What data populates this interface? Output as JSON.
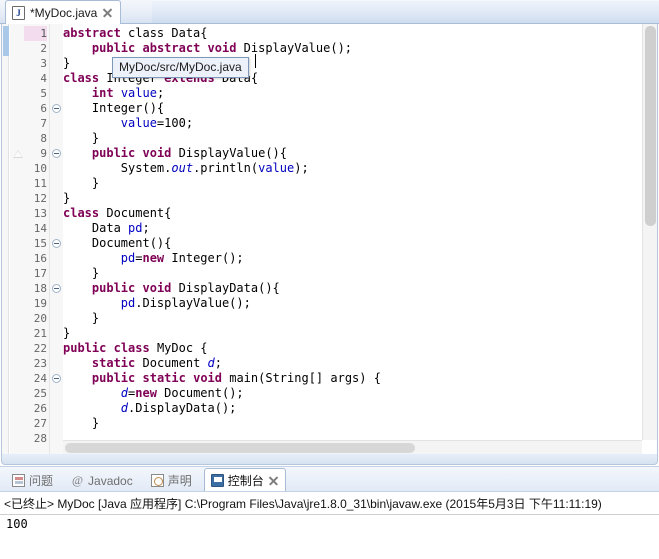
{
  "editor": {
    "tab": {
      "label": "*MyDoc.java",
      "icon": "java-file-icon",
      "close": "close-icon"
    },
    "tooltip": "MyDoc/src/MyDoc.java",
    "lines": [
      {
        "n": "1",
        "current": true,
        "changed": true,
        "fold": false,
        "warn": false,
        "html": "<span class=\"kw\">abstract</span> class Data{"
      },
      {
        "n": "2",
        "current": false,
        "changed": true,
        "fold": false,
        "warn": false,
        "html": "    <span class=\"kw\">public</span> <span class=\"kw\">abstract</span> <span class=\"kw\">void</span> DisplayValue();"
      },
      {
        "n": "3",
        "current": false,
        "changed": false,
        "fold": false,
        "warn": false,
        "html": "}"
      },
      {
        "n": "4",
        "current": false,
        "changed": false,
        "fold": false,
        "warn": false,
        "html": "<span class=\"kw\">class</span> Integer <span class=\"kw\">extends</span> Data{"
      },
      {
        "n": "5",
        "current": false,
        "changed": false,
        "fold": false,
        "warn": false,
        "html": "    <span class=\"kw\">int</span> <span class=\"fld\">value</span>;"
      },
      {
        "n": "6",
        "current": false,
        "changed": false,
        "fold": true,
        "warn": false,
        "html": "    Integer(){"
      },
      {
        "n": "7",
        "current": false,
        "changed": false,
        "fold": false,
        "warn": false,
        "html": "        <span class=\"fld\">value</span>=100;"
      },
      {
        "n": "8",
        "current": false,
        "changed": false,
        "fold": false,
        "warn": false,
        "html": "    }"
      },
      {
        "n": "9",
        "current": false,
        "changed": false,
        "fold": true,
        "warn": true,
        "html": "    <span class=\"kw\">public</span> <span class=\"kw\">void</span> DisplayValue(){"
      },
      {
        "n": "10",
        "current": false,
        "changed": false,
        "fold": false,
        "warn": false,
        "html": "        System.<span class=\"sfld\">out</span>.println(<span class=\"fld\">value</span>);"
      },
      {
        "n": "11",
        "current": false,
        "changed": false,
        "fold": false,
        "warn": false,
        "html": "    }"
      },
      {
        "n": "12",
        "current": false,
        "changed": false,
        "fold": false,
        "warn": false,
        "html": "}"
      },
      {
        "n": "13",
        "current": false,
        "changed": false,
        "fold": false,
        "warn": false,
        "html": "<span class=\"kw\">class</span> Document{"
      },
      {
        "n": "14",
        "current": false,
        "changed": false,
        "fold": false,
        "warn": false,
        "html": "    Data <span class=\"fld\">pd</span>;"
      },
      {
        "n": "15",
        "current": false,
        "changed": false,
        "fold": true,
        "warn": false,
        "html": "    Document(){"
      },
      {
        "n": "16",
        "current": false,
        "changed": false,
        "fold": false,
        "warn": false,
        "html": "        <span class=\"fld\">pd</span>=<span class=\"kw\">new</span> Integer();"
      },
      {
        "n": "17",
        "current": false,
        "changed": false,
        "fold": false,
        "warn": false,
        "html": "    }"
      },
      {
        "n": "18",
        "current": false,
        "changed": false,
        "fold": true,
        "warn": false,
        "html": "    <span class=\"kw\">public</span> <span class=\"kw\">void</span> DisplayData(){"
      },
      {
        "n": "19",
        "current": false,
        "changed": false,
        "fold": false,
        "warn": false,
        "html": "        <span class=\"fld\">pd</span>.DisplayValue();"
      },
      {
        "n": "20",
        "current": false,
        "changed": false,
        "fold": false,
        "warn": false,
        "html": "    }"
      },
      {
        "n": "21",
        "current": false,
        "changed": false,
        "fold": false,
        "warn": false,
        "html": "}"
      },
      {
        "n": "22",
        "current": false,
        "changed": false,
        "fold": false,
        "warn": false,
        "html": "<span class=\"kw\">public</span> <span class=\"kw\">class</span> MyDoc {"
      },
      {
        "n": "23",
        "current": false,
        "changed": false,
        "fold": false,
        "warn": false,
        "html": "    <span class=\"kw\">static</span> Document <span class=\"sfld\">d</span>;"
      },
      {
        "n": "24",
        "current": false,
        "changed": false,
        "fold": true,
        "warn": false,
        "html": "    <span class=\"kw\">public</span> <span class=\"kw\">static</span> <span class=\"kw\">void</span> main(String[] args) {"
      },
      {
        "n": "25",
        "current": false,
        "changed": false,
        "fold": false,
        "warn": false,
        "html": "        <span class=\"sfld\">d</span>=<span class=\"kw\">new</span> Document();"
      },
      {
        "n": "26",
        "current": false,
        "changed": false,
        "fold": false,
        "warn": false,
        "html": "        <span class=\"sfld\">d</span>.DisplayData();"
      },
      {
        "n": "27",
        "current": false,
        "changed": false,
        "fold": false,
        "warn": false,
        "html": "    }"
      },
      {
        "n": "28",
        "current": false,
        "changed": false,
        "fold": false,
        "warn": false,
        "html": ""
      }
    ]
  },
  "console": {
    "tabs": [
      {
        "label": "问题",
        "icon": "problems-icon",
        "selected": false
      },
      {
        "label": "Javadoc",
        "icon": "javadoc-icon",
        "selected": false
      },
      {
        "label": "声明",
        "icon": "declaration-icon",
        "selected": false
      },
      {
        "label": "控制台",
        "icon": "console-icon",
        "selected": true
      }
    ],
    "close": "close-icon",
    "header": "<已终止> MyDoc [Java 应用程序] C:\\Program Files\\Java\\jre1.8.0_31\\bin\\javaw.exe (2015年5月3日 下午11:11:19)",
    "output": "100"
  },
  "colors": {
    "keyword": "#7f0055",
    "field": "#0000c0",
    "tab_border": "#a8bcd6",
    "changed_line": "#aac8e8",
    "current_line_number": "#f2dcee"
  }
}
